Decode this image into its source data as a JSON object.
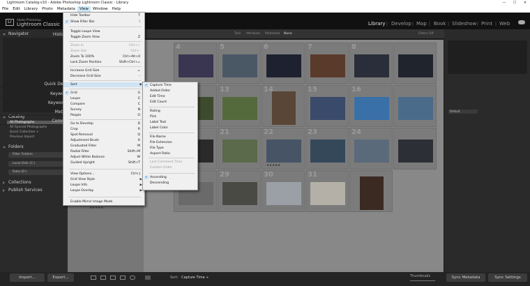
{
  "window": {
    "title": "Lightroom Catalog-v10 - Adobe Photoshop Lightroom Classic - Library",
    "minimize": "—",
    "maximize": "☐",
    "close": "✕"
  },
  "menubar": [
    "File",
    "Edit",
    "Library",
    "Photo",
    "Metadata",
    "View",
    "Window",
    "Help"
  ],
  "identity": {
    "small": "Adobe Photoshop",
    "large": "Lightroom Classic"
  },
  "modules": [
    "Library",
    "Develop",
    "Map",
    "Book",
    "Slideshow",
    "Print",
    "Web"
  ],
  "filter_bar": {
    "tabs": [
      "Text",
      "Attribute",
      "Metadata",
      "None"
    ],
    "filters_off": "Filters Off"
  },
  "left_panel": {
    "navigator": "Navigator",
    "catalog": "Catalog",
    "catalog_items": [
      "All Photographs",
      "All Synced Photographs",
      "Quick Collection +",
      "Previous Import"
    ],
    "folders": "Folders",
    "filter_folders": "Filter Folders",
    "drives": [
      "Local Disk (C:)",
      "Data (D:)"
    ],
    "collections": "Collections",
    "publish_services": "Publish Services"
  },
  "right_panel": {
    "histogram": "Histogram",
    "quick_develop": "Quick Develop",
    "keywording": "Keywording",
    "keyword_list": "Keyword List",
    "metadata": "Metadata",
    "metadata_preset": "Default",
    "comments": "Comments"
  },
  "grid": {
    "numbers": [
      "4",
      "5",
      "6",
      "7",
      "8",
      "12",
      "13",
      "14",
      "15",
      "16",
      "20",
      "21",
      "22",
      "23",
      "24",
      "28",
      "29",
      "30",
      "31"
    ],
    "stars": "★★★★★"
  },
  "bottom": {
    "import": "Import...",
    "export": "Export...",
    "sort_label": "Sort:",
    "sort_value": "Capture Time ÷",
    "thumbnails": "Thumbnails",
    "sync_metadata": "Sync Metadata",
    "sync_settings": "Sync Settings"
  },
  "view_menu": [
    {
      "label": "Hide Toolbar",
      "sc": "T"
    },
    {
      "label": "Show Filter Bar",
      "sc": "\\",
      "check": true
    },
    {
      "label": "Toggle Loupe View",
      "sc": ""
    },
    {
      "label": "Toggle Zoom View",
      "sc": "Z"
    },
    {
      "label": "Zoom In",
      "sc": "Ctrl++",
      "dis": true
    },
    {
      "label": "Zoom Out",
      "sc": "Ctrl+-",
      "dis": true
    },
    {
      "label": "Zoom To 100%",
      "sc": "Ctrl+Alt+0"
    },
    {
      "label": "Lock Zoom Position",
      "sc": "Shift+Ctrl+="
    },
    {
      "label": "Increase Grid Size",
      "sc": "="
    },
    {
      "label": "Decrease Grid Size",
      "sc": "-"
    },
    {
      "label": "Sort",
      "sc": "",
      "sub": true,
      "hl": true
    },
    {
      "label": "Grid",
      "sc": "G",
      "check": true
    },
    {
      "label": "Loupe",
      "sc": "E"
    },
    {
      "label": "Compare",
      "sc": "C"
    },
    {
      "label": "Survey",
      "sc": "N"
    },
    {
      "label": "People",
      "sc": "O"
    },
    {
      "label": "Go to Develop",
      "sc": "D"
    },
    {
      "label": "Crop",
      "sc": "R"
    },
    {
      "label": "Spot Removal",
      "sc": "Q"
    },
    {
      "label": "Adjustment Brush",
      "sc": "K"
    },
    {
      "label": "Graduated Filter",
      "sc": "M"
    },
    {
      "label": "Radial Filter",
      "sc": "Shift+M"
    },
    {
      "label": "Adjust White Balance",
      "sc": "W"
    },
    {
      "label": "Guided Upright",
      "sc": "Shift+T"
    },
    {
      "label": "View Options...",
      "sc": "Ctrl+J"
    },
    {
      "label": "Grid View Style",
      "sc": "",
      "sub": true
    },
    {
      "label": "Loupe Info",
      "sc": "",
      "sub": true
    },
    {
      "label": "Loupe Overlay",
      "sc": "",
      "sub": true
    },
    {
      "label": "Enable Mirror Image Mode",
      "sc": ""
    }
  ],
  "sort_menu": [
    {
      "label": "Capture Time",
      "check": true
    },
    {
      "label": "Added Order"
    },
    {
      "label": "Edit Time"
    },
    {
      "label": "Edit Count"
    },
    {
      "label": "Rating"
    },
    {
      "label": "Pick"
    },
    {
      "label": "Label Text"
    },
    {
      "label": "Label Color"
    },
    {
      "label": "File Name"
    },
    {
      "label": "File Extension"
    },
    {
      "label": "File Type"
    },
    {
      "label": "Aspect Ratio"
    },
    {
      "label": "Last Comment Time",
      "dis": true
    },
    {
      "label": "Custom Order",
      "dis": true
    },
    {
      "label": "Ascending",
      "check": true
    },
    {
      "label": "Descending"
    }
  ]
}
